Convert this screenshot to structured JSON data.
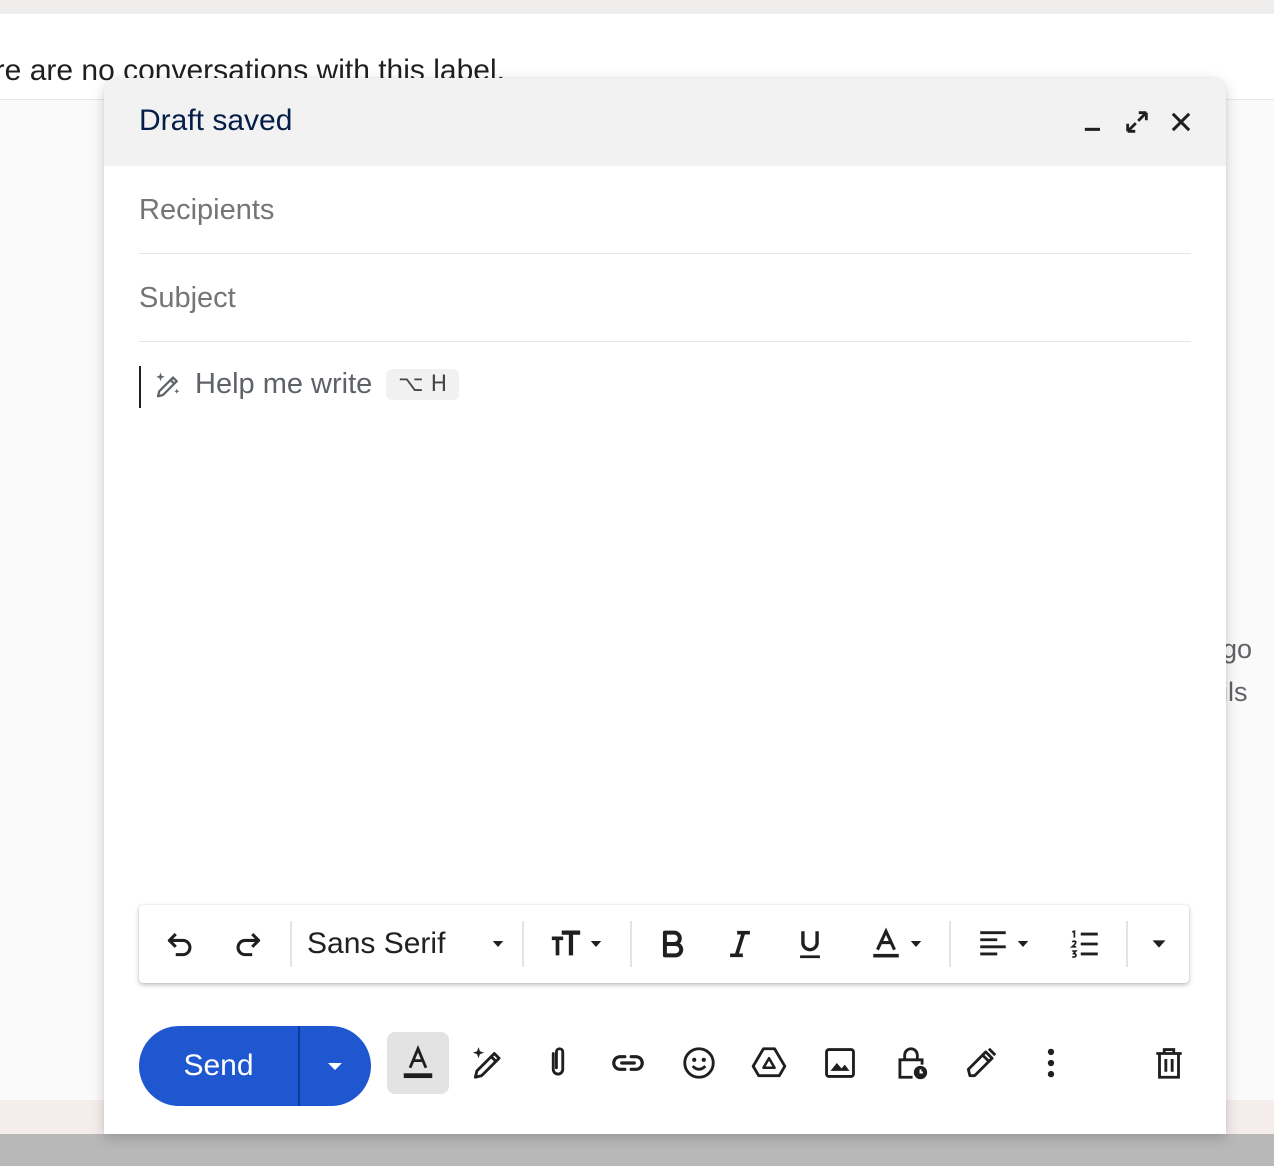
{
  "background": {
    "banner_text": "ere are no conversations with this label.",
    "side_text_1": "go",
    "side_text_2": "ils"
  },
  "compose": {
    "title": "Draft saved",
    "header_buttons": {
      "minimize": "minimize-icon",
      "fullscreen": "expand-icon",
      "close": "close-icon"
    },
    "recipients_placeholder": "Recipients",
    "recipients_value": "",
    "subject_placeholder": "Subject",
    "subject_value": "",
    "help_me_write": "Help me write",
    "help_me_write_shortcut": "⌥ H",
    "body_value": ""
  },
  "formatting_toolbar": {
    "undo": "undo-icon",
    "redo": "redo-icon",
    "font_family": "Sans Serif",
    "font_size": "text-size-icon",
    "bold": "bold-icon",
    "italic": "italic-icon",
    "underline": "underline-icon",
    "text_color": "text-color-icon",
    "align": "align-left-icon",
    "numbered_list": "numbered-list-icon",
    "more": "chevron-down-icon"
  },
  "bottom_toolbar": {
    "send_label": "Send",
    "send_options": "chevron-down-icon",
    "items": [
      "formatting-options-icon",
      "help-me-write-icon",
      "attach-icon",
      "link-icon",
      "emoji-icon",
      "drive-icon",
      "image-icon",
      "confidential-mode-icon",
      "signature-icon",
      "more-options-icon",
      "delete-icon"
    ],
    "formatting_active": true
  },
  "colors": {
    "send_button": "#1f57d1",
    "title_text": "#041e49",
    "header_bg": "#f2f2f2"
  }
}
